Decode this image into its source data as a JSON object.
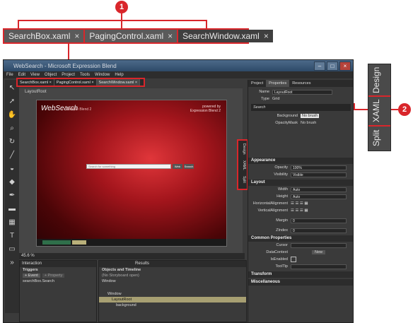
{
  "callouts": {
    "one": "1",
    "two": "2"
  },
  "zoom_tabs": [
    {
      "label": "SearchBox.xaml",
      "close": "×"
    },
    {
      "label": "PagingControl.xaml",
      "close": "×"
    },
    {
      "label": "SearchWindow.xaml",
      "close": "×"
    }
  ],
  "zoom_view_tabs": [
    "Design",
    "XAML",
    "Split"
  ],
  "window": {
    "title": "WebSearch - Microsoft Expression Blend",
    "menu": [
      "File",
      "Edit",
      "View",
      "Object",
      "Project",
      "Tools",
      "Window",
      "Help"
    ],
    "min": "–",
    "max": "□",
    "close": "×"
  },
  "doc_tabs": [
    {
      "label": "SearchBox.xaml",
      "close": "×"
    },
    {
      "label": "PagingControl.xaml",
      "close": "×"
    },
    {
      "label": "SearchWindow.xaml",
      "close": "×"
    }
  ],
  "breadcrumb": "LayoutRoot",
  "canvas": {
    "logo": "WebSearch",
    "subtitle": "Sample Blend 2",
    "right_line1": "powered by",
    "right_line2": "Expression Blend 2",
    "search_placeholder": "Search for something",
    "btn1": "Web",
    "btn2": "Search"
  },
  "view_tabs": [
    "Design",
    "XAML",
    "Split"
  ],
  "zoom_level": "45.6 %",
  "interaction": {
    "tab1": "Interaction",
    "tab2": "Results",
    "triggers_title": "Triggers",
    "event_btn": "+ Event",
    "property_btn": "+ Property",
    "trigger_item": "searchBox.Search",
    "objects_title": "Objects and Timeline",
    "storyboard": "(No Storyboard open)",
    "tree_window1": "Window",
    "tree_window2": "Window",
    "tree_layoutroot": "LayoutRoot",
    "tree_background": "background"
  },
  "right_panel": {
    "tabs": [
      "Project",
      "Properties",
      "Resources"
    ],
    "name_label": "Name",
    "name_value": "LayoutRoot",
    "type_label": "Type",
    "type_value": "Grid",
    "search_label": "Search",
    "brush_background": "Background",
    "brush_background_val": "No brush",
    "brush_opacitymask": "OpacityMask",
    "brush_opacitymask_val": "No brush",
    "sections": {
      "appearance": "Appearance",
      "layout": "Layout",
      "common": "Common Properties",
      "transform": "Transform",
      "misc": "Miscellaneous"
    },
    "appearance": [
      {
        "label": "Opacity",
        "value": "100%"
      },
      {
        "label": "Visibility",
        "value": "Visible"
      }
    ],
    "layout": [
      {
        "label": "Width",
        "value": "Auto"
      },
      {
        "label": "Height",
        "value": "Auto"
      },
      {
        "label": "HorizontalAlignment",
        "value": ""
      },
      {
        "label": "VerticalAlignment",
        "value": ""
      },
      {
        "label": "Margin",
        "value": "0"
      },
      {
        "label": "ZIndex",
        "value": "0"
      }
    ],
    "common": [
      {
        "label": "Cursor",
        "value": ""
      },
      {
        "label": "DataContext",
        "value": "New"
      },
      {
        "label": "IsEnabled",
        "value": ""
      },
      {
        "label": "ToolTip",
        "value": ""
      }
    ]
  },
  "colors": {
    "callout_red": "#d9262b",
    "panel_dark": "#3a3a3a",
    "selection": "#a79f72"
  }
}
